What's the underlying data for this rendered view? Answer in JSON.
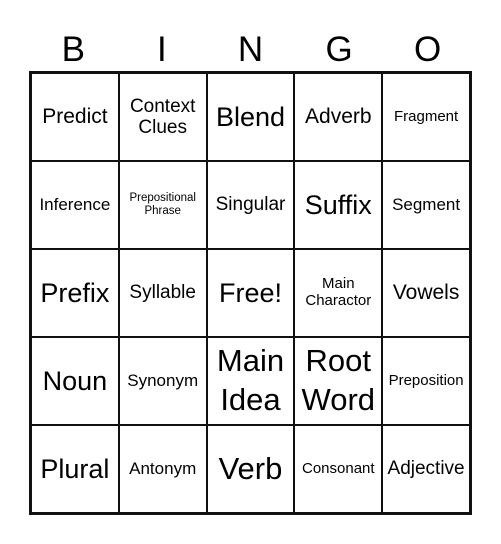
{
  "header": {
    "letters": [
      "B",
      "I",
      "N",
      "G",
      "O"
    ]
  },
  "board": {
    "rows": [
      [
        "Predict",
        "Context Clues",
        "Blend",
        "Adverb",
        "Fragment"
      ],
      [
        "Inference",
        "Prepositional Phrase",
        "Singular",
        "Suffix",
        "Segment"
      ],
      [
        "Prefix",
        "Syllable",
        "Free!",
        "Main Charactor",
        "Vowels"
      ],
      [
        "Noun",
        "Synonym",
        "Main Idea",
        "Root Word",
        "Preposition"
      ],
      [
        "Plural",
        "Antonym",
        "Verb",
        "Consonant",
        "Adjective"
      ]
    ]
  }
}
